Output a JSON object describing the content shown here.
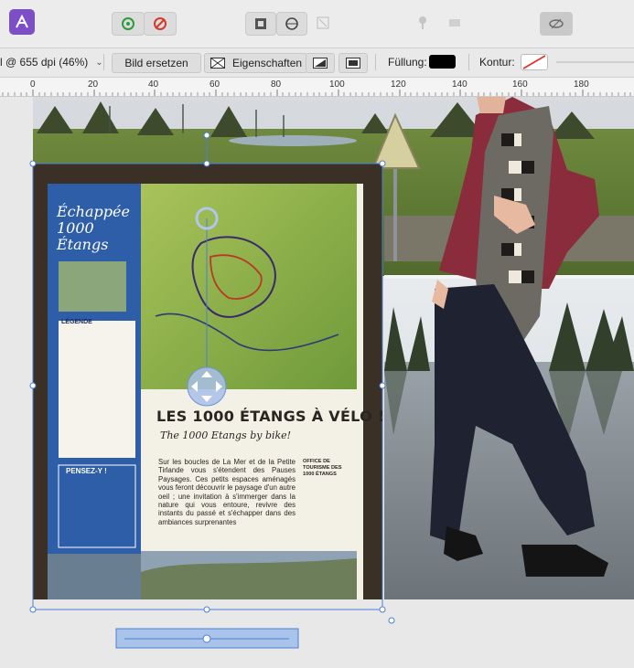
{
  "toolbar": {
    "app_icon": "affinity-photo-icon",
    "buttons": [
      "gear-snap-icon",
      "no-snap-icon",
      "arrange-front-icon",
      "align-center-icon",
      "group-icon",
      "pin-icon",
      "layer-icon",
      "view-toggle-icon"
    ]
  },
  "context": {
    "dpi_label": "l @ 655 dpi (46%)",
    "replace_label": "Bild ersetzen",
    "properties_label": "Eigenschaften",
    "fill_label": "Füllung:",
    "stroke_label": "Kontur:",
    "fill_color": "#000000",
    "stroke_color": "none"
  },
  "ruler": {
    "ticks": [
      "0",
      "20",
      "40",
      "60",
      "80",
      "100",
      "120",
      "140",
      "160",
      "180"
    ]
  },
  "sign": {
    "brand_top": "Échappée",
    "brand_bottom": "1000 Étangs",
    "legend_label": "LÉGENDE",
    "pensez_label": "PENSEZ-Y !",
    "headline": "LES 1000 ÉTANGS À VÉLO !",
    "subheadline": "The 1000 Etangs by bike!",
    "body": "Sur les boucles de La Mer et de la Petite Tirlande vous s'étendent des Pauses Paysages. Ces petits espaces aménagés vous feront découvrir le paysage d'un autre oeil ; une invitation à s'immerger dans la nature qui vous entoure, revivre des instants du passé et s'échapper dans des ambiances surprenantes",
    "office_label": "OFFICE DE TOURISME DES 1000 ÉTANGS"
  },
  "colors": {
    "accent": "#4a7fd6",
    "sign_blue": "#2e5ea8",
    "sky": "#d9dde0"
  }
}
